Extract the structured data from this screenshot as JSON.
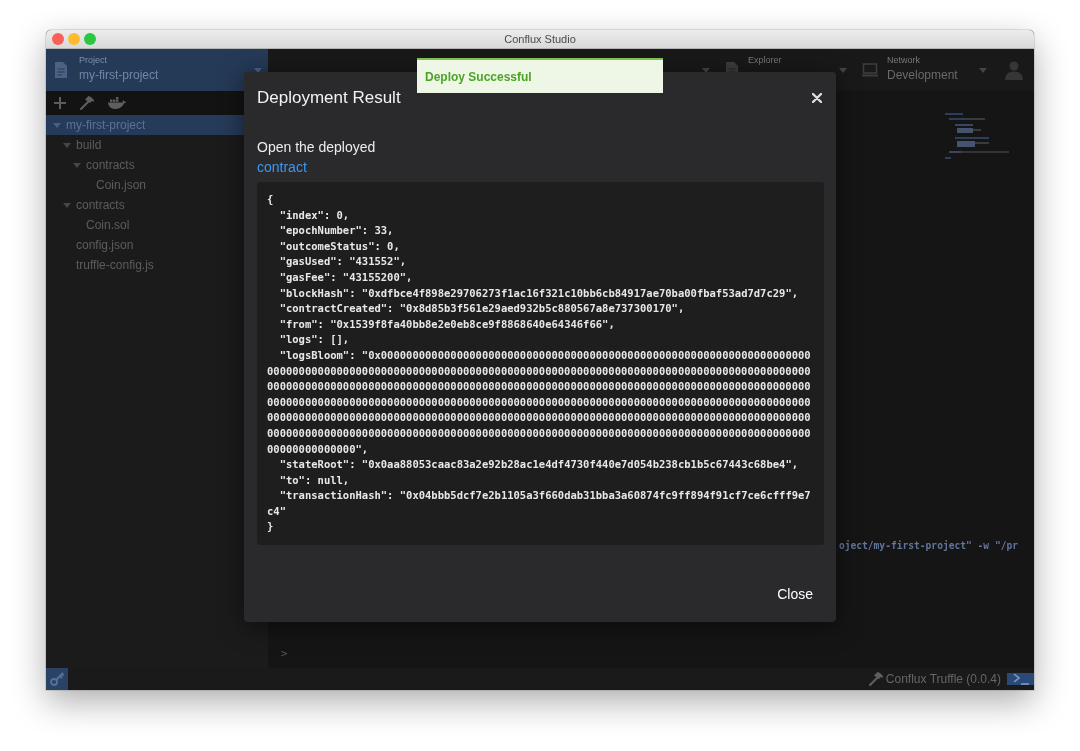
{
  "window": {
    "title": "Conflux Studio"
  },
  "header": {
    "project": {
      "label": "Project",
      "value": "my-first-project"
    },
    "explorer": {
      "label": "Explorer"
    },
    "network": {
      "label": "Network",
      "value": "Development"
    }
  },
  "sidebar": {
    "tree": [
      {
        "label": "my-first-project",
        "kind": "folder",
        "expanded": true,
        "selected": true,
        "children": [
          {
            "label": "build",
            "kind": "folder",
            "expanded": true,
            "selected": false,
            "children": [
              {
                "label": "contracts",
                "kind": "folder",
                "expanded": true,
                "selected": false,
                "children": [
                  {
                    "label": "Coin.json",
                    "kind": "file",
                    "selected": false
                  }
                ]
              }
            ]
          },
          {
            "label": "contracts",
            "kind": "folder",
            "expanded": true,
            "selected": false,
            "children": [
              {
                "label": "Coin.sol",
                "kind": "file",
                "selected": false
              }
            ]
          },
          {
            "label": "config.json",
            "kind": "file",
            "selected": false
          },
          {
            "label": "truffle-config.js",
            "kind": "file",
            "selected": false
          }
        ]
      }
    ]
  },
  "terminal": {
    "lines": [
      "oject/my-first-project\" -w \"/pr"
    ],
    "prompt": ">"
  },
  "status_bar": {
    "text": "Conflux Truffle (0.0.4)"
  },
  "toast": {
    "message": "Deploy Successful"
  },
  "dialog": {
    "title": "Deployment Result",
    "intro": "Open the deployed",
    "link": "contract",
    "result": "{\n  \"index\": 0,\n  \"epochNumber\": 33,\n  \"outcomeStatus\": 0,\n  \"gasUsed\": \"431552\",\n  \"gasFee\": \"43155200\",\n  \"blockHash\": \"0xdfbce4f898e29706273f1ac16f321c10bb6cb84917ae70ba00fbaf53ad7d7c29\",\n  \"contractCreated\": \"0x8d85b3f561e29aed932b5c880567a8e737300170\",\n  \"from\": \"0x1539f8fa40bb8e2e0eb8ce9f8868640e64346f66\",\n  \"logs\": [],\n  \"logsBloom\": \"0x00000000000000000000000000000000000000000000000000000000000000000000000000000000000000000000000000000000000000000000000000000000000000000000000000000000000000000000000000000000000000000000000000000000000000000000000000000000000000000000000000000000000000000000000000000000000000000000000000000000000000000000000000000000000000000000000000000000000000000000000000000000000000000000000000000000000000000000000000000000000000000000000000000000000000000000000000000000000000000000000000000000000000000000000000000000\",\n  \"stateRoot\": \"0x0aa88053caac83a2e92b28ac1e4df4730f440e7d054b238cb1b5c67443c68be4\",\n  \"to\": null,\n  \"transactionHash\": \"0x04bbb5dcf7e2b1105a3f660dab31bba3a60874fc9ff894f91cf7ce6cfff9e7c4\"\n}",
    "buttons": [
      "Close"
    ]
  }
}
